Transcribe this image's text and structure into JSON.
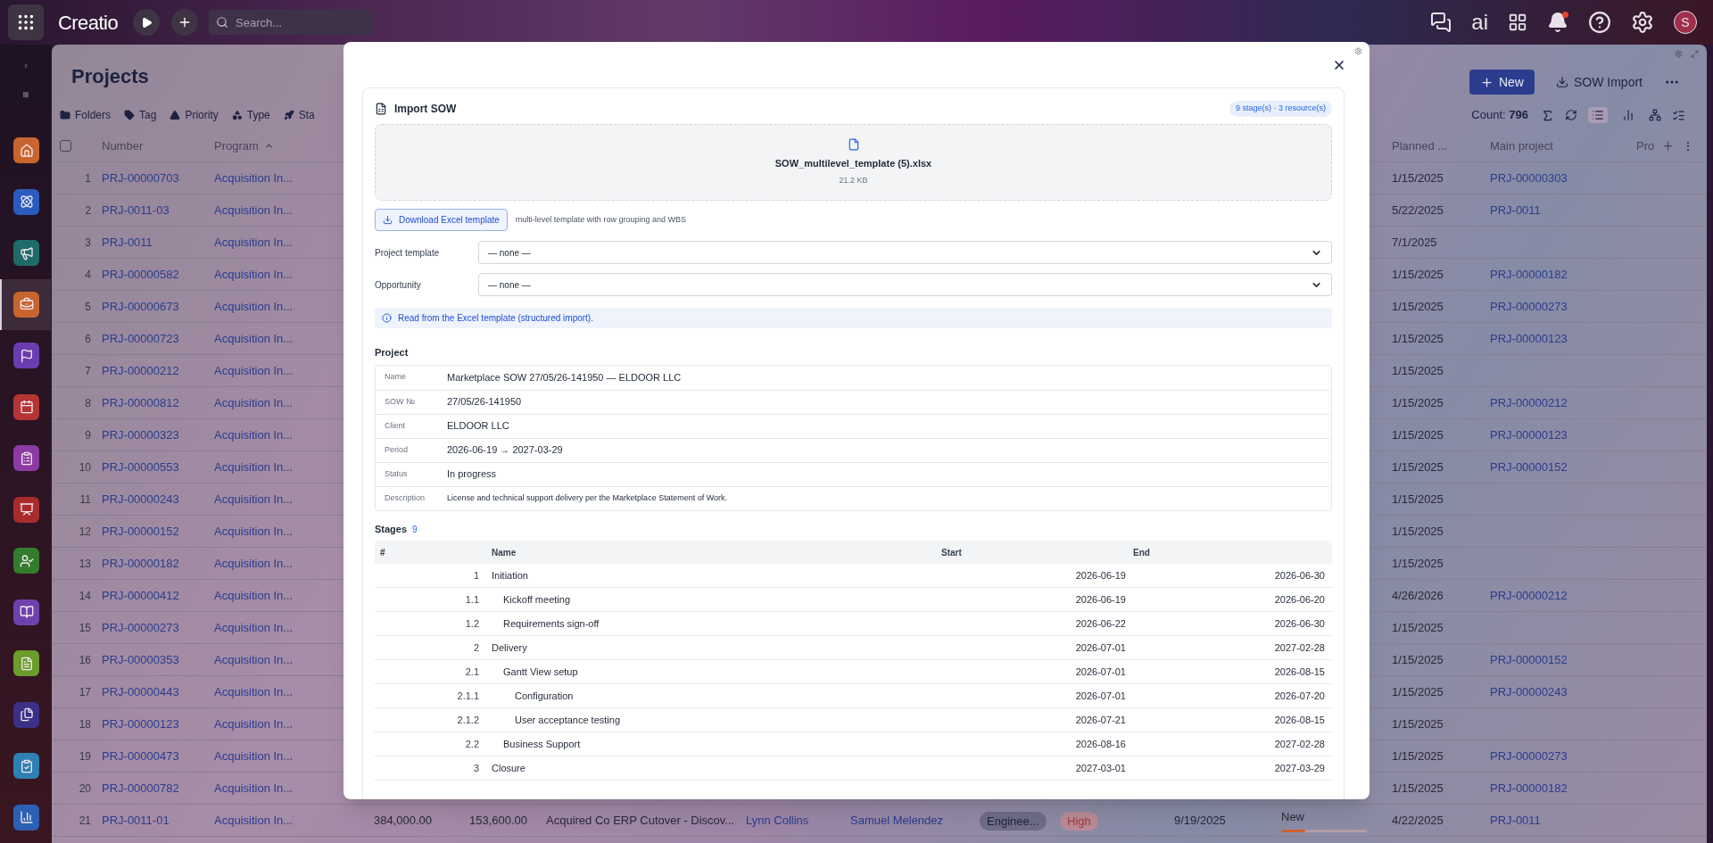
{
  "topbar": {
    "logo": "Creatio",
    "search": {
      "placeholder": "Search..."
    },
    "ai_label": "ai",
    "notifications": {
      "unread": true
    },
    "avatar": "S"
  },
  "sidebar": {
    "items": [
      {
        "color": "#c8652e",
        "selected": false
      },
      {
        "color": "#2a5cc0",
        "selected": false
      },
      {
        "color": "#1f6b6a",
        "selected": false
      },
      {
        "color": "#c8652e",
        "selected": true
      },
      {
        "color": "#6b3cb0",
        "selected": false
      },
      {
        "color": "#b53434",
        "selected": false
      },
      {
        "color": "#8b3ba3",
        "selected": false
      },
      {
        "color": "#a82c2c",
        "selected": false
      },
      {
        "color": "#327d2c",
        "selected": false
      },
      {
        "color": "#6e41ad",
        "selected": false
      },
      {
        "color": "#6c9c2c",
        "selected": false
      },
      {
        "color": "#3b3087",
        "selected": false
      },
      {
        "color": "#2f80b3",
        "selected": false
      },
      {
        "color": "#2b60b5",
        "selected": false
      }
    ]
  },
  "page": {
    "title": "Projects",
    "actions": [
      {
        "label": "New",
        "kind": "primary"
      },
      {
        "label": "SOW Import",
        "kind": "secondary"
      }
    ],
    "filters": [
      "Folders",
      "Tag",
      "Priority",
      "Type",
      "Sta"
    ],
    "count": {
      "label": "Count:",
      "value": "796"
    },
    "views": [
      {
        "selected": true
      },
      {
        "selected": false
      }
    ]
  },
  "table": {
    "select_all": {
      "checked": false
    },
    "columns": {
      "number": "Number",
      "program": {
        "label": "Program",
        "sorted_ascending": true
      },
      "planned": "Planned ...",
      "main_project": "Main project",
      "column_pro": "Pro"
    },
    "rows": [
      {
        "index": "1",
        "number": "PRJ-00000703",
        "program": "Acquisition In...",
        "planned": "1/15/2025",
        "main_project": "PRJ-00000303"
      },
      {
        "index": "2",
        "number": "PRJ-0011-03",
        "program": "Acquisition In...",
        "planned": "5/22/2025",
        "main_project": "PRJ-0011"
      },
      {
        "index": "3",
        "number": "PRJ-0011",
        "program": "Acquisition In...",
        "planned": "7/1/2025"
      },
      {
        "index": "4",
        "number": "PRJ-00000582",
        "program": "Acquisition In...",
        "planned": "1/15/2025",
        "main_project": "PRJ-00000182"
      },
      {
        "index": "5",
        "number": "PRJ-00000673",
        "program": "Acquisition In...",
        "planned": "1/15/2025",
        "main_project": "PRJ-00000273"
      },
      {
        "index": "6",
        "number": "PRJ-00000723",
        "program": "Acquisition In...",
        "planned": "1/15/2025",
        "main_project": "PRJ-00000123"
      },
      {
        "index": "7",
        "number": "PRJ-00000212",
        "program": "Acquisition In...",
        "planned": "1/15/2025"
      },
      {
        "index": "8",
        "number": "PRJ-00000812",
        "program": "Acquisition In...",
        "planned": "1/15/2025",
        "main_project": "PRJ-00000212"
      },
      {
        "index": "9",
        "number": "PRJ-00000323",
        "program": "Acquisition In...",
        "planned": "1/15/2025",
        "main_project": "PRJ-00000123"
      },
      {
        "index": "10",
        "number": "PRJ-00000553",
        "program": "Acquisition In...",
        "planned": "1/15/2025",
        "main_project": "PRJ-00000152"
      },
      {
        "index": "11",
        "number": "PRJ-00000243",
        "program": "Acquisition In...",
        "planned": "1/15/2025"
      },
      {
        "index": "12",
        "number": "PRJ-00000152",
        "program": "Acquisition In...",
        "planned": "1/15/2025"
      },
      {
        "index": "13",
        "number": "PRJ-00000182",
        "program": "Acquisition In...",
        "planned": "1/15/2025"
      },
      {
        "index": "14",
        "number": "PRJ-00000412",
        "program": "Acquisition In...",
        "planned": "4/26/2026",
        "main_project": "PRJ-00000212"
      },
      {
        "index": "15",
        "number": "PRJ-00000273",
        "program": "Acquisition In...",
        "planned": "1/15/2025"
      },
      {
        "index": "16",
        "number": "PRJ-00000353",
        "program": "Acquisition In...",
        "planned": "1/15/2025",
        "main_project": "PRJ-00000152"
      },
      {
        "index": "17",
        "number": "PRJ-00000443",
        "program": "Acquisition In...",
        "planned": "1/15/2025",
        "main_project": "PRJ-00000243"
      },
      {
        "index": "18",
        "number": "PRJ-00000123",
        "program": "Acquisition In...",
        "planned": "1/15/2025"
      },
      {
        "index": "19",
        "number": "PRJ-00000473",
        "program": "Acquisition In...",
        "planned": "1/15/2025",
        "main_project": "PRJ-00000273"
      },
      {
        "index": "20",
        "number": "PRJ-00000782",
        "program": "Acquisition In...",
        "planned": "1/15/2025",
        "main_project": "PRJ-00000182"
      },
      {
        "index": "21",
        "number": "PRJ-0011-01",
        "program": "Acquisition In...",
        "budget": "384,000.00",
        "actual": "153,600.00",
        "name": "Acquired Co ERP Cutover - Discov...",
        "manager": "Lynn Collins",
        "owner": "Samuel Melendez",
        "type": "Enginee...",
        "priority": "High",
        "date": "9/19/2025",
        "status": {
          "label": "New",
          "level": 0.28
        },
        "planned": "4/22/2025",
        "main_project": "PRJ-0011"
      }
    ]
  },
  "modal": {
    "title": "Import SOW",
    "badge": "9 stage(s) · 3 resource(s)",
    "file": {
      "name": "SOW_multilevel_template (5).xlsx",
      "size": "21.2 KB"
    },
    "download": {
      "label": "Download Excel template",
      "hint": "multi-level template with row grouping and WBS"
    },
    "selects": [
      {
        "label": "Project template",
        "value": "— none —"
      },
      {
        "label": "Opportunity",
        "value": "— none —"
      }
    ],
    "info": "Read from the Excel template (structured import).",
    "project": {
      "title": "Project",
      "fields": [
        {
          "label": "Name",
          "value": "Marketplace SOW 27/05/26-141950 — ELDOOR LLC"
        },
        {
          "label": "SOW №",
          "value": "27/05/26-141950"
        },
        {
          "label": "Client",
          "value": "ELDOOR LLC"
        },
        {
          "label": "Period",
          "value": "2026-06-19 → 2027-03-29"
        },
        {
          "label": "Status",
          "value": "In progress"
        },
        {
          "label": "Description",
          "value": "License and technical support delivery per the Marketplace Statement of Work."
        }
      ]
    },
    "stages": {
      "title": "Stages",
      "count": "9",
      "columns": [
        "#",
        "Name",
        "Start",
        "End"
      ],
      "rows": [
        {
          "num": "1",
          "name": "Initiation",
          "start": "2026-06-19",
          "end": "2026-06-30",
          "children": [
            {
              "num": "1.1",
              "name": "Kickoff meeting",
              "start": "2026-06-19",
              "end": "2026-06-20"
            },
            {
              "num": "1.2",
              "name": "Requirements sign-off",
              "start": "2026-06-22",
              "end": "2026-06-30"
            }
          ]
        },
        {
          "num": "2",
          "name": "Delivery",
          "start": "2026-07-01",
          "end": "2027-02-28",
          "children": [
            {
              "num": "2.1",
              "name": "Gantt View setup",
              "start": "2026-07-01",
              "end": "2026-08-15",
              "children": [
                {
                  "num": "2.1.1",
                  "name": "Configuration",
                  "start": "2026-07-01",
                  "end": "2026-07-20"
                },
                {
                  "num": "2.1.2",
                  "name": "User acceptance testing",
                  "start": "2026-07-21",
                  "end": "2026-08-15"
                }
              ]
            },
            {
              "num": "2.2",
              "name": "Business Support",
              "start": "2026-08-16",
              "end": "2027-02-28"
            }
          ]
        },
        {
          "num": "3",
          "name": "Closure",
          "start": "2027-03-01",
          "end": "2027-03-29"
        }
      ]
    }
  }
}
